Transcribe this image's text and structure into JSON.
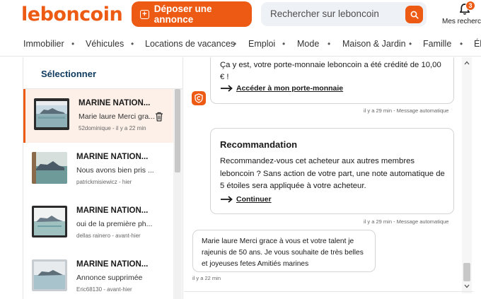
{
  "header": {
    "logo": "leboncoin",
    "deposit_label": "Déposer une annonce",
    "search_placeholder": "Rechercher sur leboncoin",
    "notif_count": "3",
    "saved_search_label": "Mes recherch"
  },
  "nav": [
    "Immobilier",
    "Véhicules",
    "Locations de vacances",
    "Emploi",
    "Mode",
    "Maison & Jardin",
    "Famille",
    "Él"
  ],
  "sidebar": {
    "title": "Sélectionner",
    "conversations": [
      {
        "name": "MARINE NATION...",
        "preview": "Marie laure Merci gra...",
        "meta": "52dominique - il y a 22 min",
        "active": true
      },
      {
        "name": "MARINE NATION...",
        "preview": "Nous avons bien pris ...",
        "meta": "patrickmisiewicz - hier"
      },
      {
        "name": "MARINE NATION...",
        "preview": "oui de la première ph...",
        "meta": "dellas rainero - avant-hier"
      },
      {
        "name": "MARINE NATION...",
        "preview": "Annonce supprimée",
        "meta": "Eric68130 - avant-hier"
      }
    ]
  },
  "chat": {
    "msg1_text": "Ça y est, votre porte-monnaie leboncoin a été crédité de 10,00 € !",
    "msg1_link": "Accéder à mon porte-monnaie",
    "msg1_ts": "il y a 29 min - Message automatique",
    "msg2_title": "Recommandation",
    "msg2_text": "Recommandez-vous cet acheteur aux autres membres leboncoin ? Sans action de votre part, une note automatique de 5 étoiles sera appliquée à votre acheteur.",
    "msg2_link": "Continuer",
    "msg2_ts": "il y a 29 min - Message automatique",
    "msg3_text": "Marie laure Merci grace à vous et votre talent je rajeunis de 50 ans. Je vous souhaite de très belles et joyeuses fetes Amitiés marines",
    "msg3_ts": "il y a 22 min"
  },
  "colors": {
    "brand": "#ec5a13",
    "title_blue": "#0e3a5e"
  }
}
